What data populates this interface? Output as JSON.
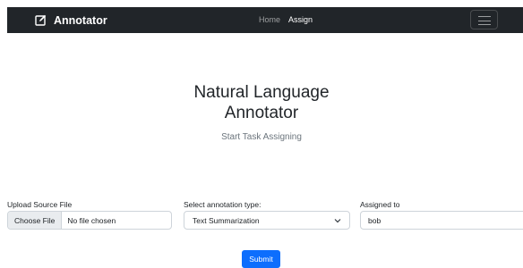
{
  "navbar": {
    "brand": "Annotator",
    "links": [
      {
        "label": "Home",
        "active": false
      },
      {
        "label": "Assign",
        "active": true
      }
    ],
    "background": "#212529"
  },
  "hero": {
    "title_line1": "Natural Language",
    "title_line2": "Annotator",
    "subtitle": "Start Task Assigning"
  },
  "form": {
    "upload": {
      "label": "Upload Source File",
      "button": "Choose File",
      "status": "No file chosen"
    },
    "annotation_type": {
      "label": "Select annotation type:",
      "selected": "Text Summarization"
    },
    "assigned_to": {
      "label": "Assigned to",
      "value": "bob"
    },
    "submit_label": "Submit",
    "submit_color": "#0d6efd"
  }
}
